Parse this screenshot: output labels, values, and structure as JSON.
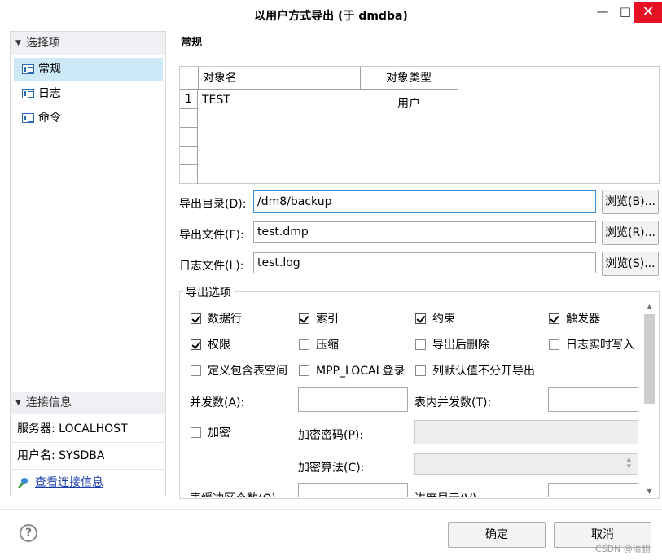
{
  "window": {
    "title": "以用户方式导出 (于 dmdba)",
    "min": "—",
    "max": "□",
    "close": "✕"
  },
  "sidebar": {
    "header": "选择项",
    "items": [
      {
        "label": "常规",
        "selected": true
      },
      {
        "label": "日志",
        "selected": false
      },
      {
        "label": "命令",
        "selected": false
      }
    ]
  },
  "connection": {
    "header": "连接信息",
    "server": "服务器: LOCALHOST",
    "user": "用户名: SYSDBA",
    "link": "查看连接信息"
  },
  "main": {
    "section_title": "常规",
    "table": {
      "columns": [
        "对象名",
        "对象类型"
      ],
      "rows": [
        {
          "num": "1",
          "name": "TEST",
          "type": "用户"
        }
      ]
    },
    "export_dir": {
      "label": "导出目录(D):",
      "value": "/dm8/backup",
      "browse": "浏览(B)..."
    },
    "export_file": {
      "label": "导出文件(F):",
      "value": "test.dmp",
      "browse": "浏览(R)..."
    },
    "log_file": {
      "label": "日志文件(L):",
      "value": "test.log",
      "browse": "浏览(S)..."
    },
    "options": {
      "title": "导出选项",
      "checkboxes": [
        {
          "label": "数据行",
          "checked": true
        },
        {
          "label": "索引",
          "checked": true
        },
        {
          "label": "约束",
          "checked": true
        },
        {
          "label": "触发器",
          "checked": true
        },
        {
          "label": "权限",
          "checked": true
        },
        {
          "label": "压缩",
          "checked": false
        },
        {
          "label": "导出后删除",
          "checked": false
        },
        {
          "label": "日志实时写入",
          "checked": false
        },
        {
          "label": "定义包含表空间",
          "checked": false
        },
        {
          "label": "MPP_LOCAL登录",
          "checked": false
        },
        {
          "label": "列默认值不分开导出",
          "checked": false
        }
      ],
      "parallel_label": "并发数(A):",
      "parallel_value": "",
      "table_parallel_label": "表内并发数(T):",
      "table_parallel_value": "",
      "encrypt": {
        "label": "加密",
        "checked": false
      },
      "encrypt_pwd_label": "加密密码(P):",
      "encrypt_algo_label": "加密算法(C):",
      "partial_left_label": "表缓冲区个数(Q)",
      "partial_right_label": "进度显示(V)"
    }
  },
  "footer": {
    "ok": "确定",
    "cancel": "取消",
    "help": "?",
    "watermark": "CSDN @清鹏"
  }
}
